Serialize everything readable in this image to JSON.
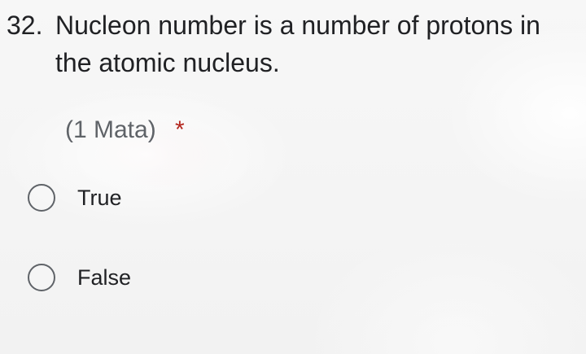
{
  "question": {
    "number": "32.",
    "text": "Nucleon number is a number of protons in the atomic nucleus.",
    "points": "(1 Mata)",
    "required_marker": "*"
  },
  "options": [
    {
      "label": "True"
    },
    {
      "label": "False"
    }
  ]
}
